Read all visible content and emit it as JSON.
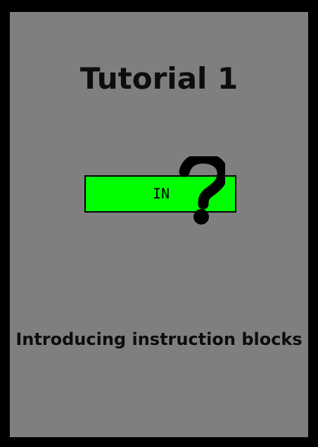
{
  "tutorial": {
    "title": "Tutorial 1",
    "subtitle": "Introducing instruction blocks"
  },
  "block": {
    "label": "IN",
    "color": "#00ff00"
  },
  "colors": {
    "frame": "#000000",
    "card": "#7f7f7f",
    "text": "#0d0d0d"
  },
  "icons": {
    "overlay": "question-mark-icon"
  }
}
